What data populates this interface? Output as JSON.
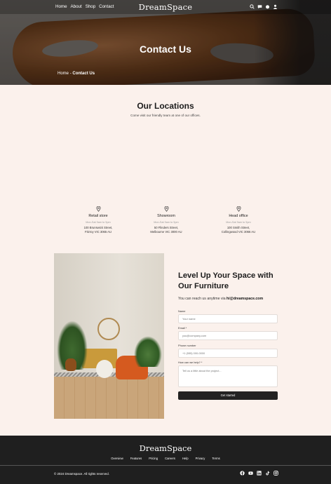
{
  "nav": {
    "links": [
      "Home",
      "About",
      "Shop",
      "Contact"
    ],
    "logo": "DreamSpace",
    "icons": [
      "search-icon",
      "chat-icon",
      "cart-icon",
      "user-icon"
    ]
  },
  "hero": {
    "title": "Contact Us",
    "breadcrumb": {
      "home": "Home",
      "separator": "-",
      "current": "Contact Us"
    }
  },
  "locations": {
    "title": "Our Locations",
    "subtitle": "Come visit our friendly team at one of our offices.",
    "offices": [
      {
        "name": "Retail store",
        "hours": "Mon-Sat 9am to 5pm",
        "address_line1": "100 Brunswick Street,",
        "address_line2": "Fitzroy VIC 3065 AU"
      },
      {
        "name": "Showroom",
        "hours": "Mon-Sat 9am to 5pm",
        "address_line1": "50 Flinders Street,",
        "address_line2": "Melbourne VIC 3000 AU"
      },
      {
        "name": "Head office",
        "hours": "Mon-Sat 9am to 5pm",
        "address_line1": "100 Smith Street,",
        "address_line2": "Collingwood VIC 3066 AU"
      }
    ]
  },
  "contact": {
    "title": "Level Up Your Space with Our Furniture",
    "reach_prefix": "You can reach us anytime via",
    "email": "hi@dreamspace.com",
    "fields": {
      "name_label": "Name",
      "name_placeholder": "Your name",
      "email_label": "Email *",
      "email_placeholder": "you@company.com",
      "phone_label": "Phone number",
      "phone_placeholder": "+1 (555) 000-0000",
      "message_label": "How can we help? *",
      "message_placeholder": "Tell us a little about the project..."
    },
    "submit_label": "Get started"
  },
  "footer": {
    "logo": "DreamSpace",
    "links": [
      "Overview",
      "Features",
      "Pricing",
      "Careers",
      "Help",
      "Privacy",
      "Terms"
    ],
    "copyright": "© 2024 Dreamspace. All rights reserved.",
    "social_icons": [
      "facebook-icon",
      "youtube-icon",
      "linkedin-icon",
      "tiktok-icon",
      "instagram-icon"
    ]
  }
}
